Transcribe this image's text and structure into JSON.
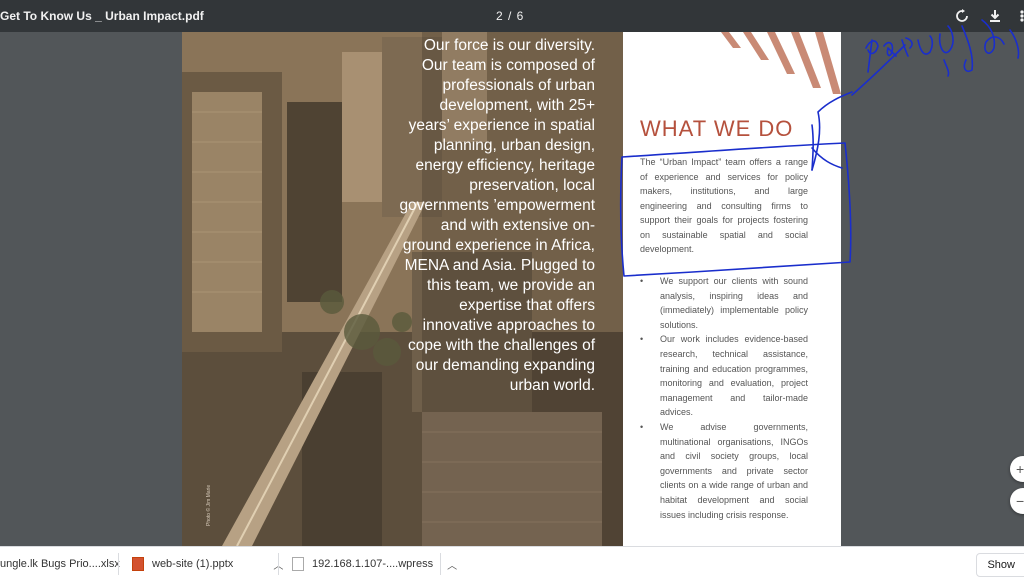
{
  "toolbar": {
    "title": "Get To Know Us _ Urban Impact.pdf",
    "page_indicator": "2 / 6",
    "icons": [
      "rotate-icon",
      "download-icon",
      "more-icon"
    ]
  },
  "page": {
    "overlay_text": "Our force is our diversity. Our team is composed of professionals of urban development, with 25+ years’ experience in spatial planning, urban design, energy efficiency, heritage preservation, local governments ’empowerment and with extensive on-ground experience in Africa, MENA and Asia. Plugged to this team, we provide an expertise that offers innovative approaches to cope with the challenges of our demanding expanding urban world.",
    "photo_credit": "Photo © Jim Marie",
    "heading": "WHAT WE DO",
    "intro": "The “Urban Impact” team offers a range of experience and services for policy makers, institutions, and large engineering and consulting firms to support their goals for projects fostering on sustainable spatial and social development.",
    "bullets": [
      "We support our clients with sound analysis, inspiring ideas and (immediately) implementable policy solutions.",
      "Our work includes evidence-based research, technical assistance, training and education programmes, monitoring and evaluation, project management and tailor-made advices.",
      "We advise governments, multinational organisations, INGOs and civil society groups, local governments and private sector clients on a wide range of urban and habitat development and social issues including crisis response."
    ],
    "accent_color": "#b5513d",
    "annotation_color": "#1a2ecc"
  },
  "downloads": {
    "items": [
      {
        "name": "ungle.lk Bugs Prio....xlsx"
      },
      {
        "name": "web-site (1).pptx"
      },
      {
        "name": "192.168.1.107-....wpress"
      }
    ],
    "show_all": "Show"
  }
}
